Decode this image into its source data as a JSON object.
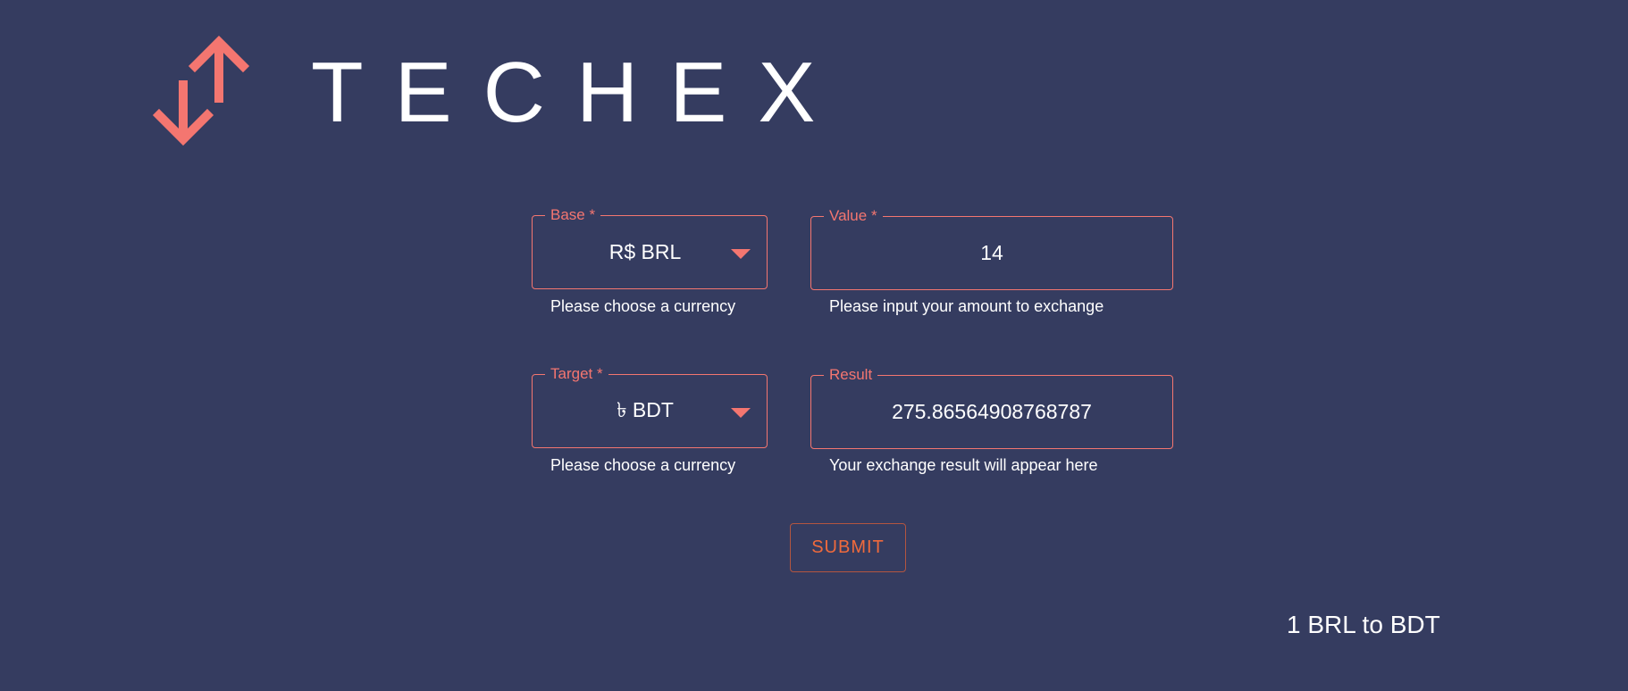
{
  "brand": {
    "name": "TECHEX",
    "icon": "up-down-arrows-icon",
    "accent_color": "#f47670"
  },
  "form": {
    "base": {
      "label": "Base *",
      "value": "R$ BRL",
      "helper": "Please choose a currency"
    },
    "value": {
      "label": "Value *",
      "value": "14",
      "helper": "Please input your amount to exchange"
    },
    "target": {
      "label": "Target *",
      "value": "৳ BDT",
      "helper": "Please choose a currency"
    },
    "result": {
      "label": "Result",
      "value": "275.86564908768787",
      "helper": "Your exchange result will appear here"
    },
    "submit_label": "SUBMIT"
  },
  "rate_caption": "1 BRL to BDT",
  "colors": {
    "background": "#353c60",
    "accent": "#f47670",
    "submit_text": "#f06a3c"
  }
}
